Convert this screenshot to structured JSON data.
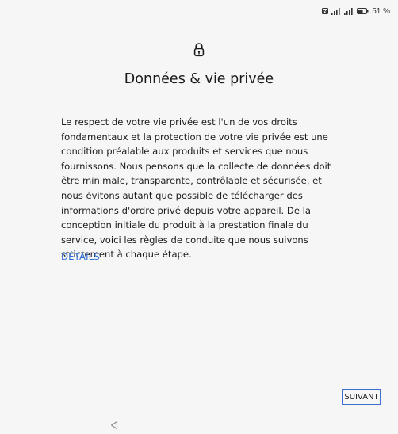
{
  "status_bar": {
    "icons": [
      "nfc-icon",
      "signal-icon",
      "signal-icon-2",
      "battery-icon"
    ],
    "battery_percent": "51 %"
  },
  "header": {
    "icon": "lock-icon",
    "title": "Données & vie privée"
  },
  "content": {
    "paragraph": "Le respect de votre vie privée est l'un de vos droits fondamentaux et la protection de votre vie privée est une condition préalable aux produits et services que nous fournissons. Nous pensons que la collecte de données doit être minimale, transparente, contrôlable et sécurisée, et nous évitons autant que possible de télécharger des informations d'ordre privé depuis votre appareil. De la conception initiale du produit à la prestation finale du service, voici les règles de conduite que nous suivons strictement à chaque étape.",
    "details_label": "DÉTAILS"
  },
  "footer": {
    "next_label": "SUIVANT"
  },
  "nav": {
    "back_icon": "back-triangle-icon"
  },
  "colors": {
    "background": "#f6f6f6",
    "link": "#2f6fd6",
    "focus_border": "#3b6fd0"
  }
}
